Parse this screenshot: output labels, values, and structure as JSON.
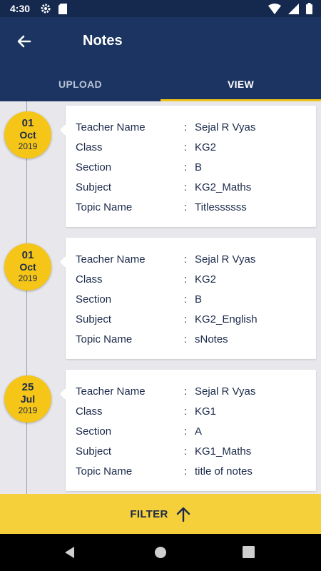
{
  "status_bar": {
    "time": "4:30",
    "left_icons": [
      "gear-icon",
      "sd-card-icon"
    ],
    "right_icons": [
      "wifi-icon",
      "signal-icon",
      "battery-icon"
    ]
  },
  "header": {
    "title": "Notes",
    "back_icon": "arrow-back-icon"
  },
  "tabs": [
    {
      "label": "UPLOAD",
      "active": false
    },
    {
      "label": "VIEW",
      "active": true
    }
  ],
  "field_labels": {
    "teacher": "Teacher Name",
    "class": "Class",
    "section": "Section",
    "subject": "Subject",
    "topic": "Topic Name",
    "separator": ":"
  },
  "entries": [
    {
      "day": "01",
      "month": "Oct",
      "year": "2019",
      "teacher": "Sejal  R Vyas",
      "class": "KG2",
      "section": "B",
      "subject": "KG2_Maths",
      "topic": "Titlessssss"
    },
    {
      "day": "01",
      "month": "Oct",
      "year": "2019",
      "teacher": "Sejal  R Vyas",
      "class": "KG2",
      "section": "B",
      "subject": "KG2_English",
      "topic": "sNotes"
    },
    {
      "day": "25",
      "month": "Jul",
      "year": "2019",
      "teacher": "Sejal  R Vyas",
      "class": "KG1",
      "section": "A",
      "subject": "KG1_Maths",
      "topic": "title of notes"
    }
  ],
  "filter": {
    "label": "FILTER",
    "icon": "arrow-up-icon"
  },
  "colors": {
    "header_bg": "#1b3461",
    "accent": "#f5c518",
    "filter_bg": "#f5d03b"
  },
  "nav_bar": [
    "back-triangle-icon",
    "home-circle-icon",
    "recents-square-icon"
  ]
}
